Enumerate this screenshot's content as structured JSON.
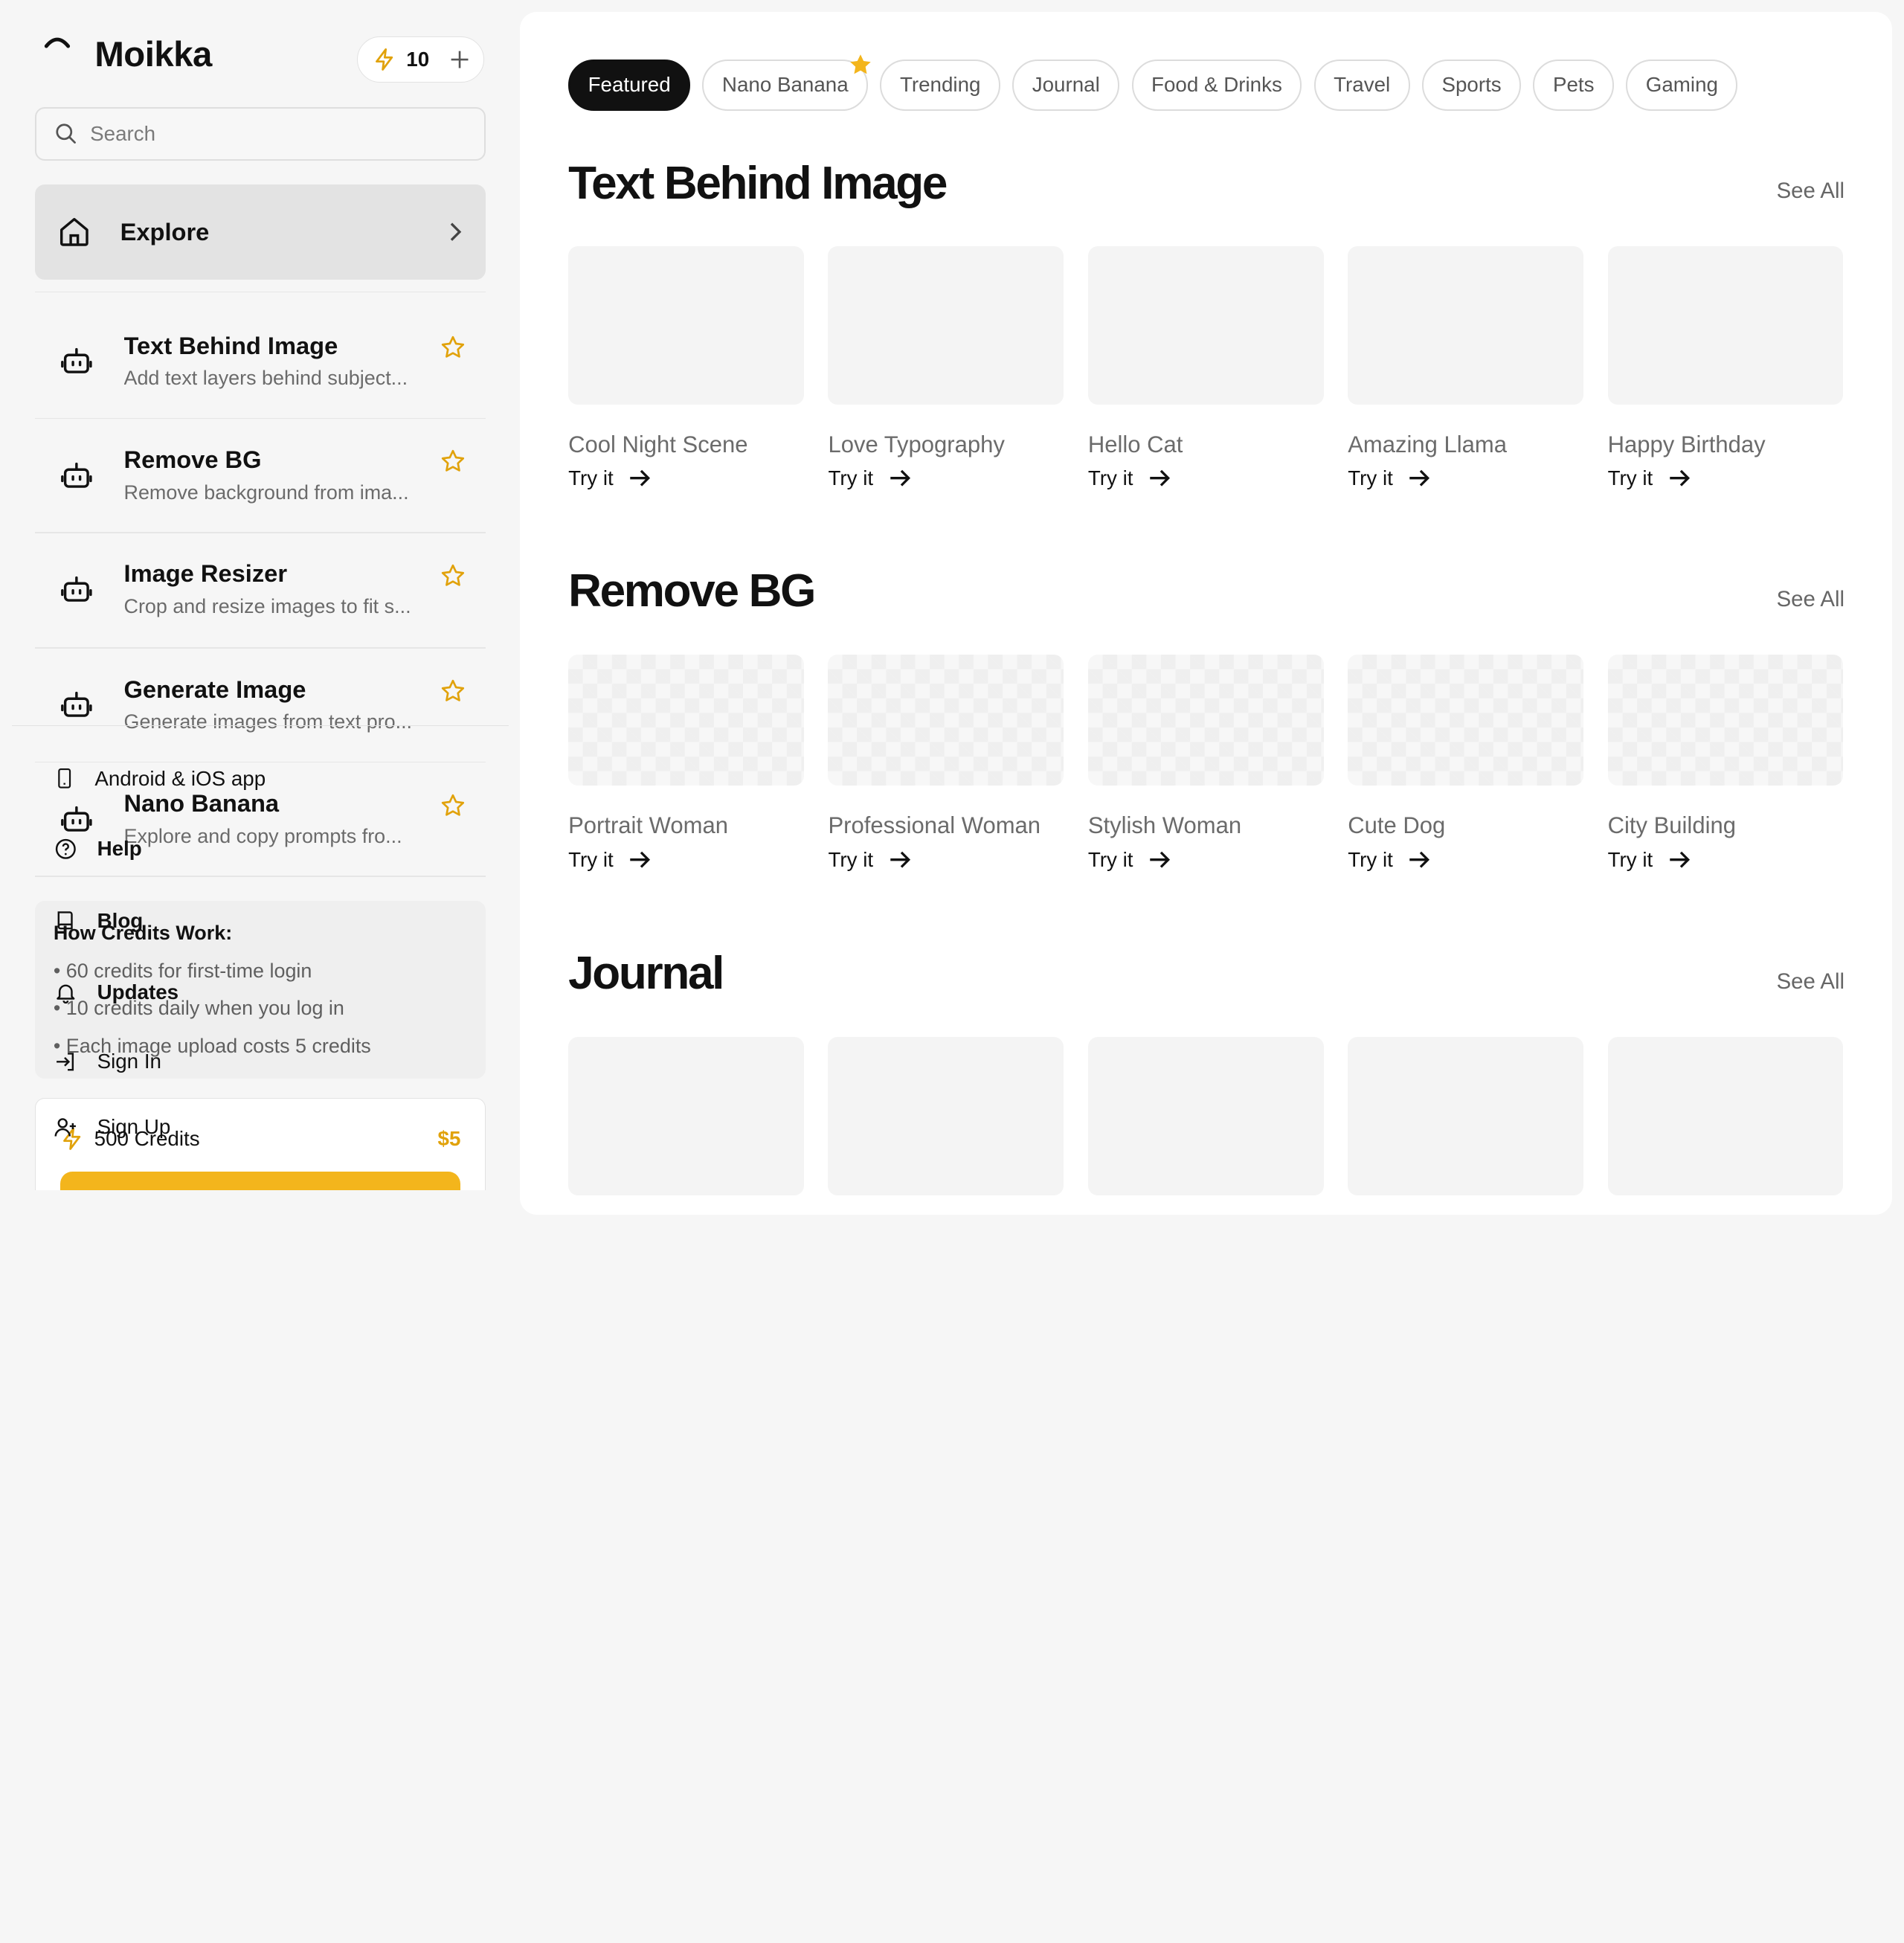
{
  "app": {
    "name": "Moikka",
    "credits": "10"
  },
  "search": {
    "placeholder": "Search"
  },
  "nav": {
    "explore_label": "Explore"
  },
  "tools": [
    {
      "title": "Text Behind Image",
      "subtitle": "Add text layers behind subject..."
    },
    {
      "title": "Remove BG",
      "subtitle": "Remove background from ima..."
    },
    {
      "title": "Image Resizer",
      "subtitle": "Crop and resize images to fit s..."
    },
    {
      "title": "Generate Image",
      "subtitle": "Generate images from text pro..."
    },
    {
      "title": "Nano Banana",
      "subtitle": "Explore and copy prompts fro..."
    }
  ],
  "footer": {
    "app_link": "Android & iOS app",
    "help": "Help",
    "blog": "Blog",
    "updates": "Updates",
    "sign_in": "Sign In",
    "sign_up": "Sign Up"
  },
  "credits_info": {
    "heading": "How Credits Work:",
    "lines": [
      "• 60 credits for first-time login",
      "• 10 credits daily when you log in",
      "• Each image upload costs 5 credits"
    ]
  },
  "purchase": {
    "label": "500 Credits",
    "price": "$5"
  },
  "categories": [
    "Featured",
    "Nano Banana",
    "Trending",
    "Journal",
    "Food & Drinks",
    "Travel",
    "Sports",
    "Pets",
    "Gaming"
  ],
  "active_category": "Featured",
  "sections": [
    {
      "title": "Text Behind Image",
      "see_all": "See All",
      "cards": [
        "Cool Night Scene",
        "Love Typography",
        "Hello Cat",
        "Amazing Llama",
        "Happy Birthday"
      ]
    },
    {
      "title": "Remove BG",
      "see_all": "See All",
      "cards": [
        "Portrait Woman",
        "Professional Woman",
        "Stylish Woman",
        "Cute Dog",
        "City Building"
      ]
    },
    {
      "title": "Journal",
      "see_all": "See All",
      "cards": []
    }
  ],
  "try_label": "Try it",
  "colors": {
    "accent": "#f3b51c",
    "active_chip": "#111111",
    "selected_nav": "#e3e3e3"
  }
}
